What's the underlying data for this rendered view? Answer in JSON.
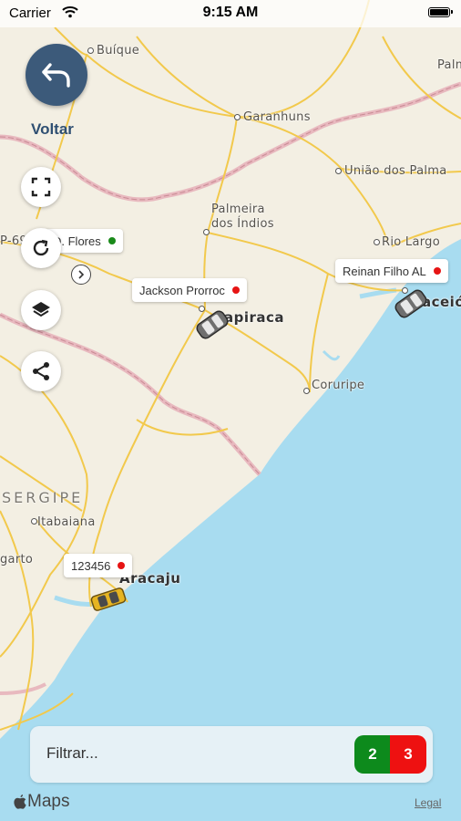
{
  "status_bar": {
    "carrier": "Carrier",
    "time": "9:15 AM"
  },
  "nav": {
    "back_label": "Voltar"
  },
  "map": {
    "labels": {
      "buique": "Buíque",
      "garanhuns": "Garanhuns",
      "palmares": "Palm",
      "uniao": "União dos Palma",
      "palmeira1": "Palmeira",
      "palmeira2": "dos Índios",
      "rio_largo": "Rio Largo",
      "arapiraca": "apiraca",
      "maceio": "aceió",
      "coruripe": "Coruripe",
      "sergipe": "SERGIPE",
      "itabaiana": "Itabaiana",
      "lagarto": "garto",
      "aracaju": "Aracaju",
      "left_edge": "P-69"
    }
  },
  "vehicles": [
    {
      "name": "D. Flores",
      "status_color": "#1a8a1a"
    },
    {
      "name": "Jackson Prorroc",
      "status_color": "#e61414"
    },
    {
      "name": "Reinan Filho AL",
      "status_color": "#e61414"
    },
    {
      "name": "123456",
      "status_color": "#e61414"
    }
  ],
  "filter": {
    "placeholder": "Filtrar...",
    "online_count": "2",
    "offline_count": "3"
  },
  "colors": {
    "online": "#0d8a1c",
    "offline": "#ee1111",
    "back_button": "#3c5a7a",
    "sea": "#a8dcf0",
    "land": "#f3efe3",
    "roads": "#f2c94c"
  },
  "footer": {
    "maps_label": "Maps",
    "legal_label": "Legal"
  },
  "icons": [
    "back-arrow-icon",
    "fullscreen-icon",
    "refresh-icon",
    "layers-icon",
    "share-icon",
    "chevron-right-icon",
    "car-icon",
    "apple-icon",
    "wifi-icon",
    "battery-icon"
  ]
}
